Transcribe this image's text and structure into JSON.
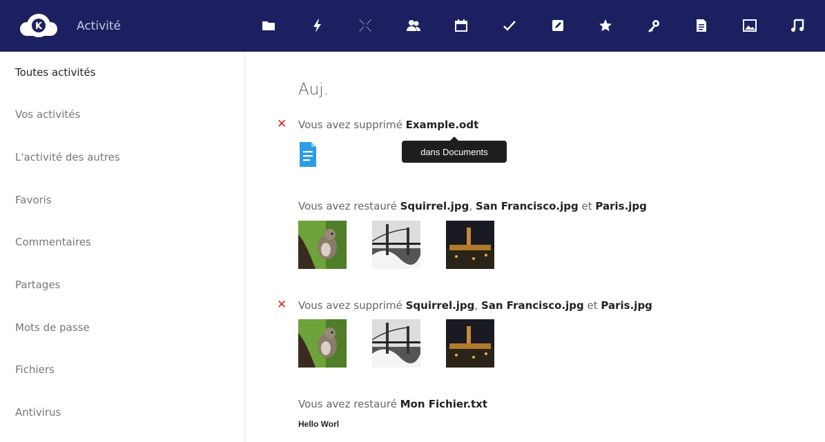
{
  "app": {
    "title": "Activité"
  },
  "nav_icons": [
    "folder-icon",
    "lightning-icon",
    "gallery-icon",
    "contacts-icon",
    "calendar-icon",
    "tasks-icon",
    "notes-icon",
    "bookmarks-icon",
    "passwords-icon",
    "documents-icon",
    "pictures-icon",
    "music-icon"
  ],
  "colors": {
    "header": "#1d2060",
    "delete": "#e02020",
    "doc_icon": "#2d9be8"
  },
  "sidebar": {
    "items": [
      {
        "label": "Toutes activités",
        "active": true
      },
      {
        "label": "Vos activités"
      },
      {
        "label": "L'activité des autres"
      },
      {
        "label": "Favoris"
      },
      {
        "label": "Commentaires"
      },
      {
        "label": "Partages"
      },
      {
        "label": "Mots de passe"
      },
      {
        "label": "Fichiers"
      },
      {
        "label": "Antivirus"
      }
    ]
  },
  "main": {
    "day": "Auj.",
    "activities": [
      {
        "type": "delete",
        "prefix": "Vous avez supprimé ",
        "file": "Example.odt",
        "tooltip": "dans Documents"
      },
      {
        "type": "restore",
        "prefix": "Vous avez restauré ",
        "file1": "Squirrel.jpg",
        "sep": ", ",
        "file2": "San Francisco.jpg",
        "conj": " et ",
        "file3": "Paris.jpg"
      },
      {
        "type": "delete",
        "prefix": "Vous avez supprimé ",
        "file1": "Squirrel.jpg",
        "sep": ", ",
        "file2": "San Francisco.jpg",
        "conj": " et ",
        "file3": "Paris.jpg"
      },
      {
        "type": "restore",
        "prefix": "Vous avez restauré ",
        "file": "Mon Fichier.txt",
        "preview": "Hello Worl"
      }
    ]
  }
}
